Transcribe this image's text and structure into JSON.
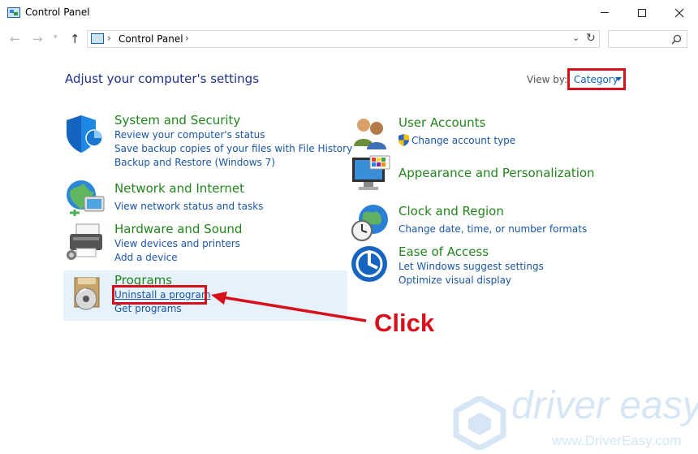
{
  "window": {
    "title": "Control Panel",
    "min_icon": "minimize-icon",
    "max_icon": "maximize-icon",
    "close_icon": "close-icon"
  },
  "nav": {
    "back_icon": "back-arrow-icon",
    "forward_icon": "forward-arrow-icon",
    "up_icon": "up-arrow-icon",
    "breadcrumb": "Control Panel",
    "search_placeholder": ""
  },
  "main": {
    "heading": "Adjust your computer's settings",
    "view_by_label": "View by:",
    "view_by_value": "Category"
  },
  "categories_left": [
    {
      "title": "System and Security",
      "icon": "shield-icon",
      "links": [
        "Review your computer's status",
        "Save backup copies of your files with File History",
        "Backup and Restore (Windows 7)"
      ]
    },
    {
      "title": "Network and Internet",
      "icon": "network-globe-icon",
      "links": [
        "View network status and tasks"
      ]
    },
    {
      "title": "Hardware and Sound",
      "icon": "printer-icon",
      "links": [
        "View devices and printers",
        "Add a device"
      ]
    },
    {
      "title": "Programs",
      "icon": "programs-disc-icon",
      "links": [
        "Uninstall a program",
        "Get programs"
      ]
    }
  ],
  "categories_right": [
    {
      "title": "User Accounts",
      "icon": "users-icon",
      "links": [
        "Change account type"
      ]
    },
    {
      "title": "Appearance and Personalization",
      "icon": "monitor-palette-icon",
      "links": []
    },
    {
      "title": "Clock and Region",
      "icon": "clock-globe-icon",
      "links": [
        "Change date, time, or number formats"
      ]
    },
    {
      "title": "Ease of Access",
      "icon": "ease-of-access-icon",
      "links": [
        "Let Windows suggest settings",
        "Optimize visual display"
      ]
    }
  ],
  "annotation": {
    "callout": "Click"
  },
  "watermark": {
    "brand": "driver easy",
    "url": "www.DriverEasy.com"
  },
  "colors": {
    "category_title": "#22851c",
    "link": "#1a56a5",
    "heading": "#1e3287",
    "highlight_red": "#d8101b",
    "programs_hover": "#e5f1fb"
  }
}
